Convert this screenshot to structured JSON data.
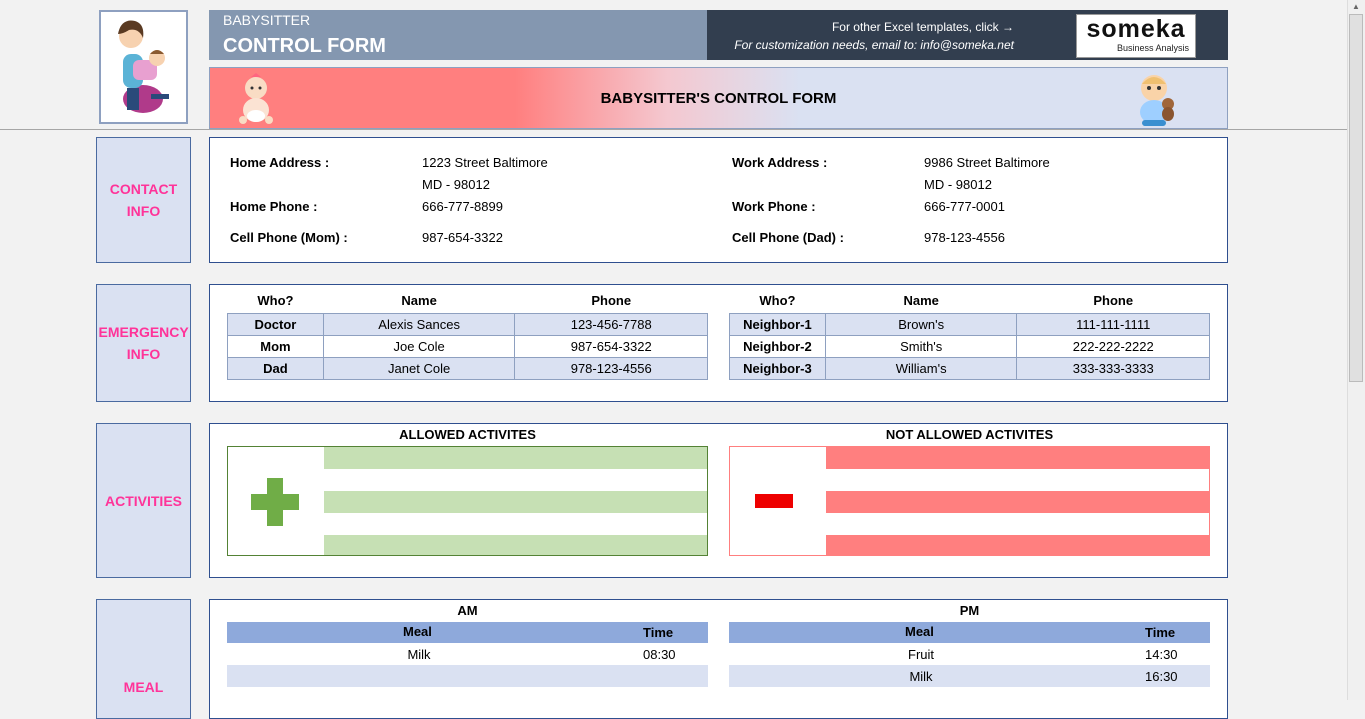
{
  "header": {
    "title_small": "BABYSITTER",
    "title_big": "CONTROL FORM",
    "promo_line1": "For other Excel templates, click →",
    "promo_line2": "For customization needs, email to: info@someka.net",
    "brand_name": "someka",
    "brand_sub": "Business Analysis",
    "banner_title": "BABYSITTER'S CONTROL FORM"
  },
  "contact": {
    "label": "CONTACT INFO",
    "home_address_label": "Home Address :",
    "home_address_1": "1223 Street Baltimore",
    "home_address_2": "MD - 98012",
    "home_phone_label": "Home Phone :",
    "home_phone": "666-777-8899",
    "cell_mom_label": "Cell Phone (Mom) :",
    "cell_mom": "987-654-3322",
    "work_address_label": "Work Address :",
    "work_address_1": "9986 Street Baltimore",
    "work_address_2": "MD - 98012",
    "work_phone_label": "Work Phone :",
    "work_phone": "666-777-0001",
    "cell_dad_label": "Cell Phone (Dad) :",
    "cell_dad": "978-123-4556"
  },
  "emergency": {
    "label": "EMERGENCY INFO",
    "headers": [
      "Who?",
      "Name",
      "Phone"
    ],
    "left": [
      {
        "who": "Doctor",
        "name": "Alexis Sances",
        "phone": "123-456-7788"
      },
      {
        "who": "Mom",
        "name": "Joe Cole",
        "phone": "987-654-3322"
      },
      {
        "who": "Dad",
        "name": "Janet Cole",
        "phone": "978-123-4556"
      }
    ],
    "right": [
      {
        "who": "Neighbor-1",
        "name": "Brown's",
        "phone": "111-111-1111"
      },
      {
        "who": "Neighbor-2",
        "name": "Smith's",
        "phone": "222-222-2222"
      },
      {
        "who": "Neighbor-3",
        "name": "William's",
        "phone": "333-333-3333"
      }
    ]
  },
  "activities": {
    "label": "ACTIVITIES",
    "allowed_title": "ALLOWED ACTIVITES",
    "not_allowed_title": "NOT ALLOWED ACTIVITES",
    "allowed_color": "#c6e0b4",
    "not_allowed_color": "#ff7f7f",
    "plus_color": "#70ad47",
    "minus_color": "#ee0000"
  },
  "meal": {
    "label": "MEAL",
    "am_title": "AM",
    "pm_title": "PM",
    "meal_header": "Meal",
    "time_header": "Time",
    "am_rows": [
      {
        "meal": "Milk",
        "time": "08:30"
      },
      {
        "meal": "",
        "time": ""
      }
    ],
    "pm_rows": [
      {
        "meal": "Fruit",
        "time": "14:30"
      },
      {
        "meal": "Milk",
        "time": "16:30"
      }
    ]
  },
  "colors": {
    "accent_pink": "#ff3399",
    "title_bar": "#8497b0",
    "promo_bar": "#323e4f",
    "label_bg": "#dae1f2",
    "meal_header_bg": "#8ea9db"
  }
}
